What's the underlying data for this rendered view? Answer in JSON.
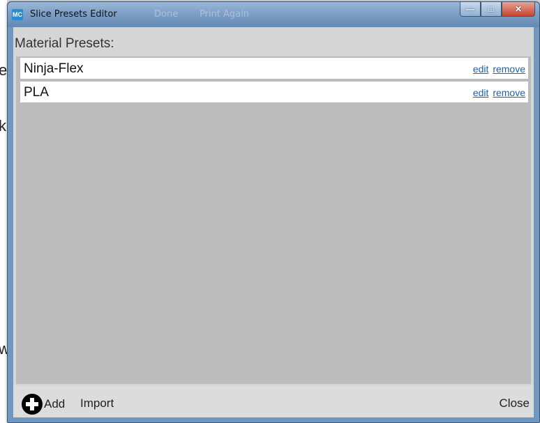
{
  "window": {
    "title": "Slice Presets Editor",
    "app_icon_text": "MC",
    "background_title_fragments": [
      "Done",
      "Print Again"
    ],
    "controls": [
      "minimize",
      "maximize",
      "close"
    ]
  },
  "background_chars": [
    "e",
    "k",
    "w"
  ],
  "heading": "Material Presets:",
  "presets": [
    {
      "name": "Ninja-Flex",
      "edit_label": "edit",
      "remove_label": "remove"
    },
    {
      "name": "PLA",
      "edit_label": "edit",
      "remove_label": "remove"
    }
  ],
  "footer": {
    "add_label": "Add",
    "import_label": "Import",
    "close_label": "Close"
  },
  "colors": {
    "link": "#1a5fb4",
    "list_background": "#bcbcbc",
    "client_background": "#d6d6d6"
  }
}
